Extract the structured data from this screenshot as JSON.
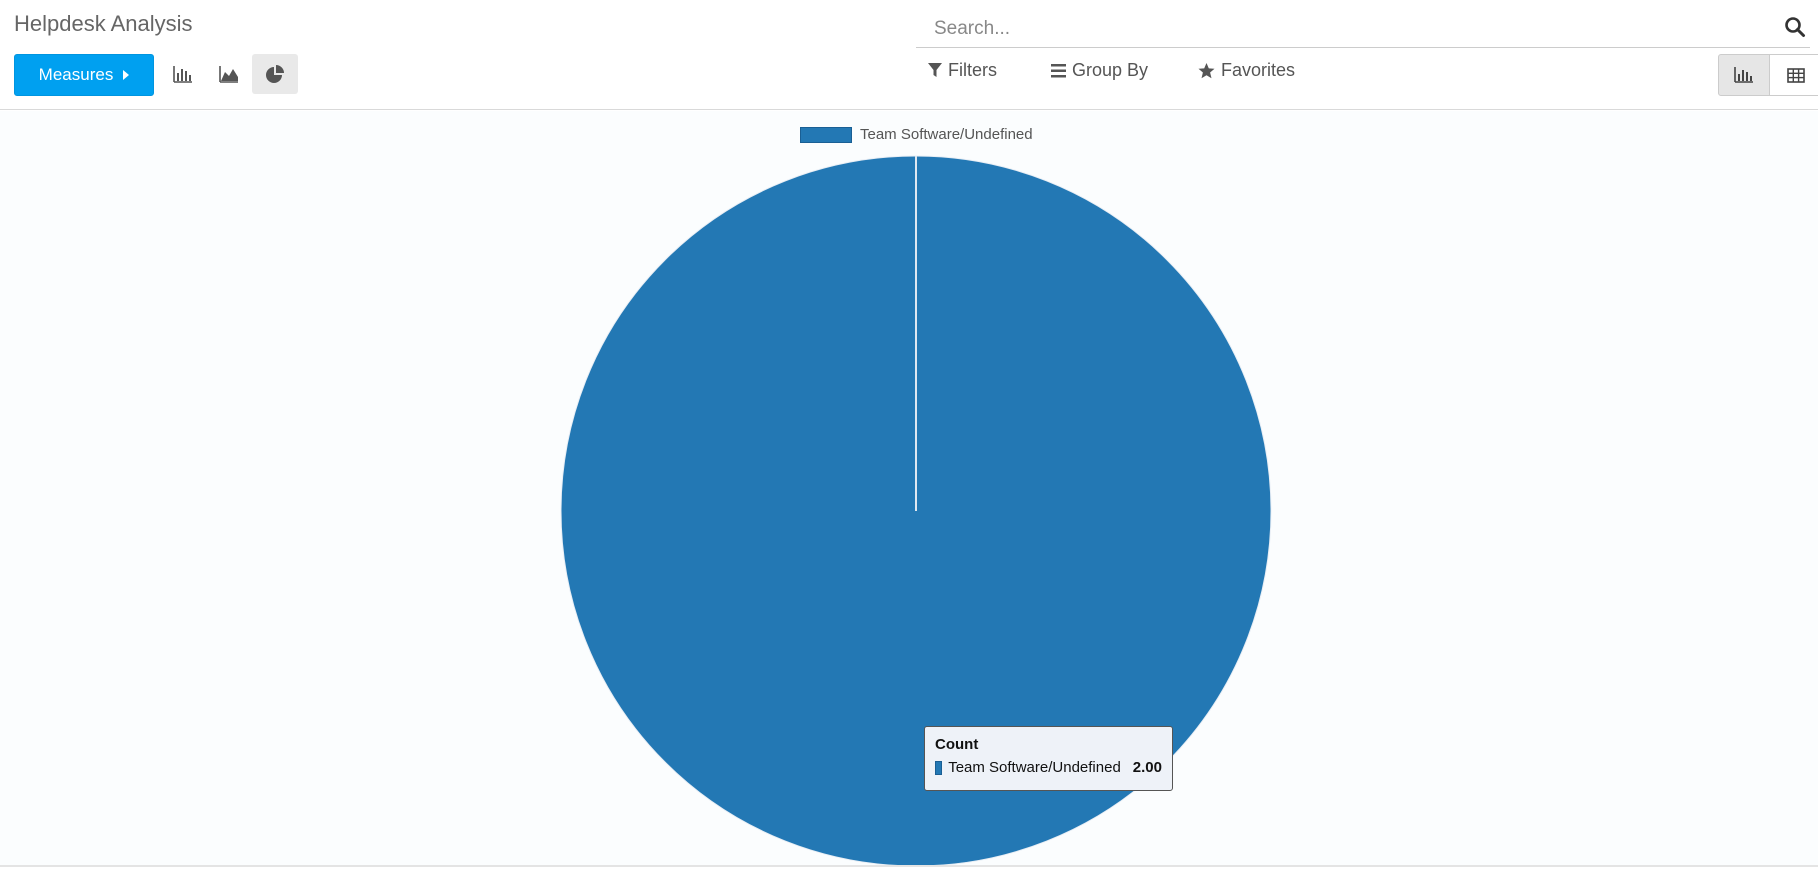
{
  "breadcrumb": {
    "title": "Helpdesk Analysis"
  },
  "search": {
    "placeholder": "Search..."
  },
  "toolbar": {
    "measures_label": "Measures",
    "chart_types": [
      {
        "name": "bar-chart",
        "active": false
      },
      {
        "name": "line-chart",
        "active": false
      },
      {
        "name": "pie-chart",
        "active": true
      }
    ]
  },
  "filters": {
    "filters_label": "Filters",
    "group_by_label": "Group By",
    "favorites_label": "Favorites"
  },
  "view_switcher": [
    {
      "name": "graph-view",
      "active": true
    },
    {
      "name": "pivot-view",
      "active": false
    }
  ],
  "colors": {
    "accent": "#00a0f0",
    "pie": "#2378b4"
  },
  "chart_data": {
    "type": "pie",
    "categories": [
      "Team Software/Undefined"
    ],
    "values": [
      2.0
    ],
    "legend": "top",
    "tooltip": {
      "title": "Count",
      "label": "Team Software/Undefined",
      "value": "2.00"
    }
  }
}
